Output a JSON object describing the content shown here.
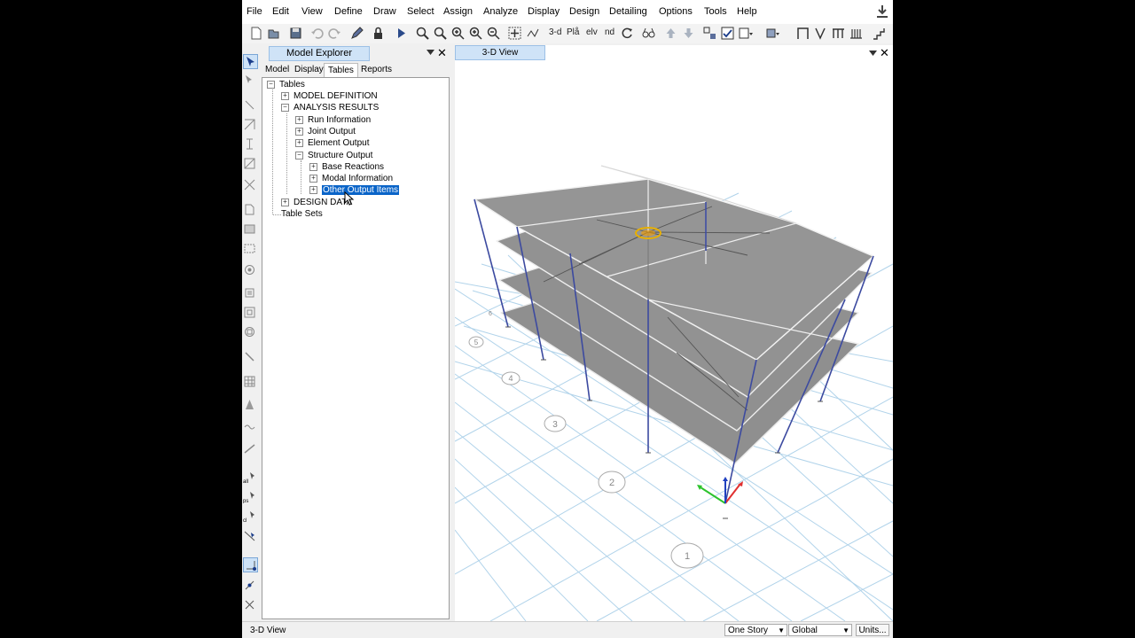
{
  "menu": [
    "File",
    "Edit",
    "View",
    "Define",
    "Draw",
    "Select",
    "Assign",
    "Analyze",
    "Display",
    "Design",
    "Detailing",
    "Options",
    "Tools",
    "Help"
  ],
  "toolbar": {
    "label_3d": "3-d",
    "label_pla": "Plå",
    "label_elv": "elv",
    "label_nd": "nd"
  },
  "explorer": {
    "title": "Model Explorer",
    "tabs": [
      "Model",
      "Display",
      "Tables",
      "Reports"
    ],
    "active_tab": "Tables",
    "tree": {
      "root": "Tables",
      "model_definition": "MODEL DEFINITION",
      "analysis_results": "ANALYSIS RESULTS",
      "run_information": "Run Information",
      "joint_output": "Joint Output",
      "element_output": "Element Output",
      "structure_output": "Structure Output",
      "base_reactions": "Base Reactions",
      "modal_information": "Modal Information",
      "other_output_items": "Other Output Items",
      "design_data": "DESIGN DATA",
      "table_sets": "Table Sets"
    }
  },
  "view": {
    "tab_label": "3-D View",
    "grid_bubbles": [
      "1",
      "2",
      "3",
      "4",
      "5",
      "6"
    ],
    "colors": {
      "slab": "#8f8f8f",
      "column": "#3c4aa0",
      "grid": "#a9cfe8",
      "selected": "#e8b000"
    }
  },
  "status": {
    "text": "3-D View",
    "story_select": "One Story",
    "coord_select": "Global",
    "units_button": "Units..."
  }
}
